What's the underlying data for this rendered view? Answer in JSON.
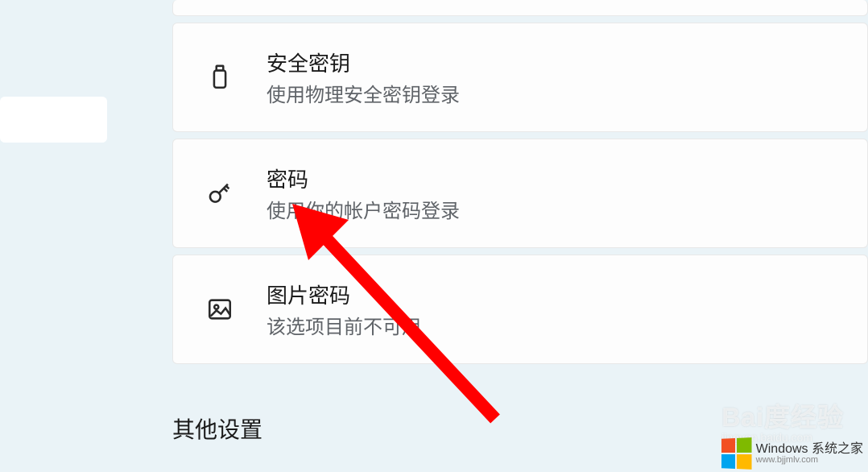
{
  "cards": {
    "security_key": {
      "title": "安全密钥",
      "desc": "使用物理安全密钥登录"
    },
    "password": {
      "title": "密码",
      "desc": "使用你的帐户密码登录"
    },
    "picture_password": {
      "title": "图片密码",
      "desc": "该选项目前不可用"
    }
  },
  "section_other": "其他设置",
  "watermarks": {
    "baidu_main": "Bai度经验",
    "baidu_sub": "jingyan.baidu.com",
    "windows_line1": "Windows 系统之家",
    "windows_line2": "www.bjjmlv.com"
  }
}
